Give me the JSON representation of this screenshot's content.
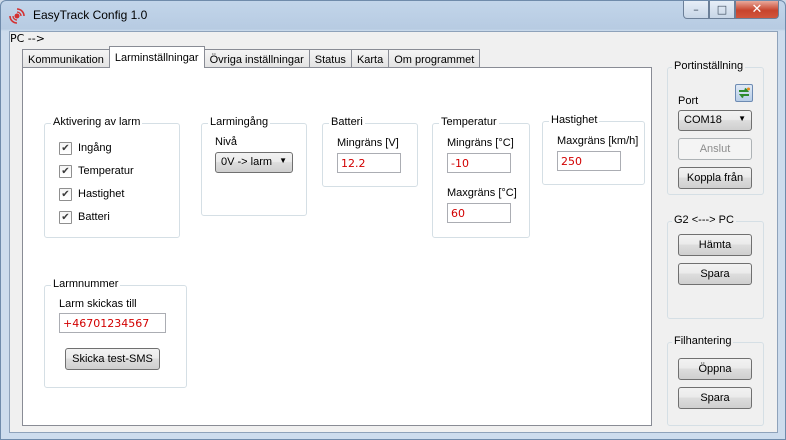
{
  "window": {
    "title": "EasyTrack Config 1.0",
    "controls": {
      "minimize": "–",
      "maximize": "□",
      "close": "✕"
    }
  },
  "tabs": [
    {
      "label": "Kommunikation",
      "active": false
    },
    {
      "label": "Larminställningar",
      "active": true
    },
    {
      "label": "Övriga inställningar",
      "active": false
    },
    {
      "label": "Status",
      "active": false
    },
    {
      "label": "Karta",
      "active": false
    },
    {
      "label": "Om programmet",
      "active": false
    }
  ],
  "alarm_activation": {
    "title": "Aktivering av larm",
    "items": [
      {
        "label": "Ingång",
        "checked": true
      },
      {
        "label": "Temperatur",
        "checked": true
      },
      {
        "label": "Hastighet",
        "checked": true
      },
      {
        "label": "Batteri",
        "checked": true
      }
    ]
  },
  "alarm_input": {
    "title": "Larmingång",
    "level_label": "Nivå",
    "level_value": "0V -> larm"
  },
  "battery": {
    "title": "Batteri",
    "min_label": "Mingräns [V]",
    "min_value": "12.2"
  },
  "temperature": {
    "title": "Temperatur",
    "min_label": "Mingräns [°C]",
    "min_value": "-10",
    "max_label": "Maxgräns [°C]",
    "max_value": "60"
  },
  "speed": {
    "title": "Hastighet",
    "max_label": "Maxgräns [km/h]",
    "max_value": "250"
  },
  "alarm_number": {
    "title": "Larmnummer",
    "sent_to_label": "Larm skickas till",
    "phone_value": "+46701234567",
    "test_sms_button": "Skicka test-SMS"
  },
  "port_settings": {
    "title": "Portinställning",
    "port_label": "Port",
    "port_value": "COM18",
    "connect_button": "Anslut",
    "disconnect_button": "Koppla från"
  },
  "device_sync": {
    "title": "G2 <---> PC",
    "fetch_button": "Hämta",
    "save_button": "Spara"
  },
  "file_handling": {
    "title": "Filhantering",
    "open_button": "Öppna",
    "save_button": "Spara"
  },
  "colors": {
    "value_text": "#d20000",
    "close_button": "#c7442d",
    "window_frame": "#b7cbe2"
  }
}
